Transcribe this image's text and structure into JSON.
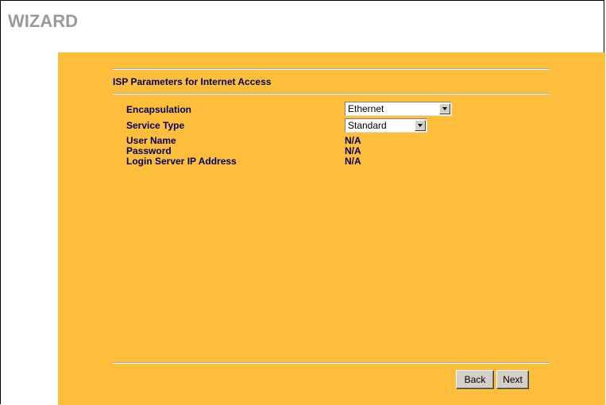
{
  "header": {
    "title": "WIZARD"
  },
  "section": {
    "title": "ISP Parameters for Internet Access"
  },
  "fields": {
    "encapsulation": {
      "label": "Encapsulation",
      "value": "Ethernet"
    },
    "service_type": {
      "label": "Service Type",
      "value": "Standard"
    },
    "user_name": {
      "label": "User Name",
      "value": "N/A"
    },
    "password": {
      "label": "Password",
      "value": "N/A"
    },
    "login_server_ip": {
      "label": "Login Server IP Address",
      "value": "N/A"
    }
  },
  "buttons": {
    "back": "Back",
    "next": "Next"
  },
  "colors": {
    "panel_background": "#FDBE3C",
    "label_text": "#000060",
    "title_text": "#9a9a9a"
  }
}
